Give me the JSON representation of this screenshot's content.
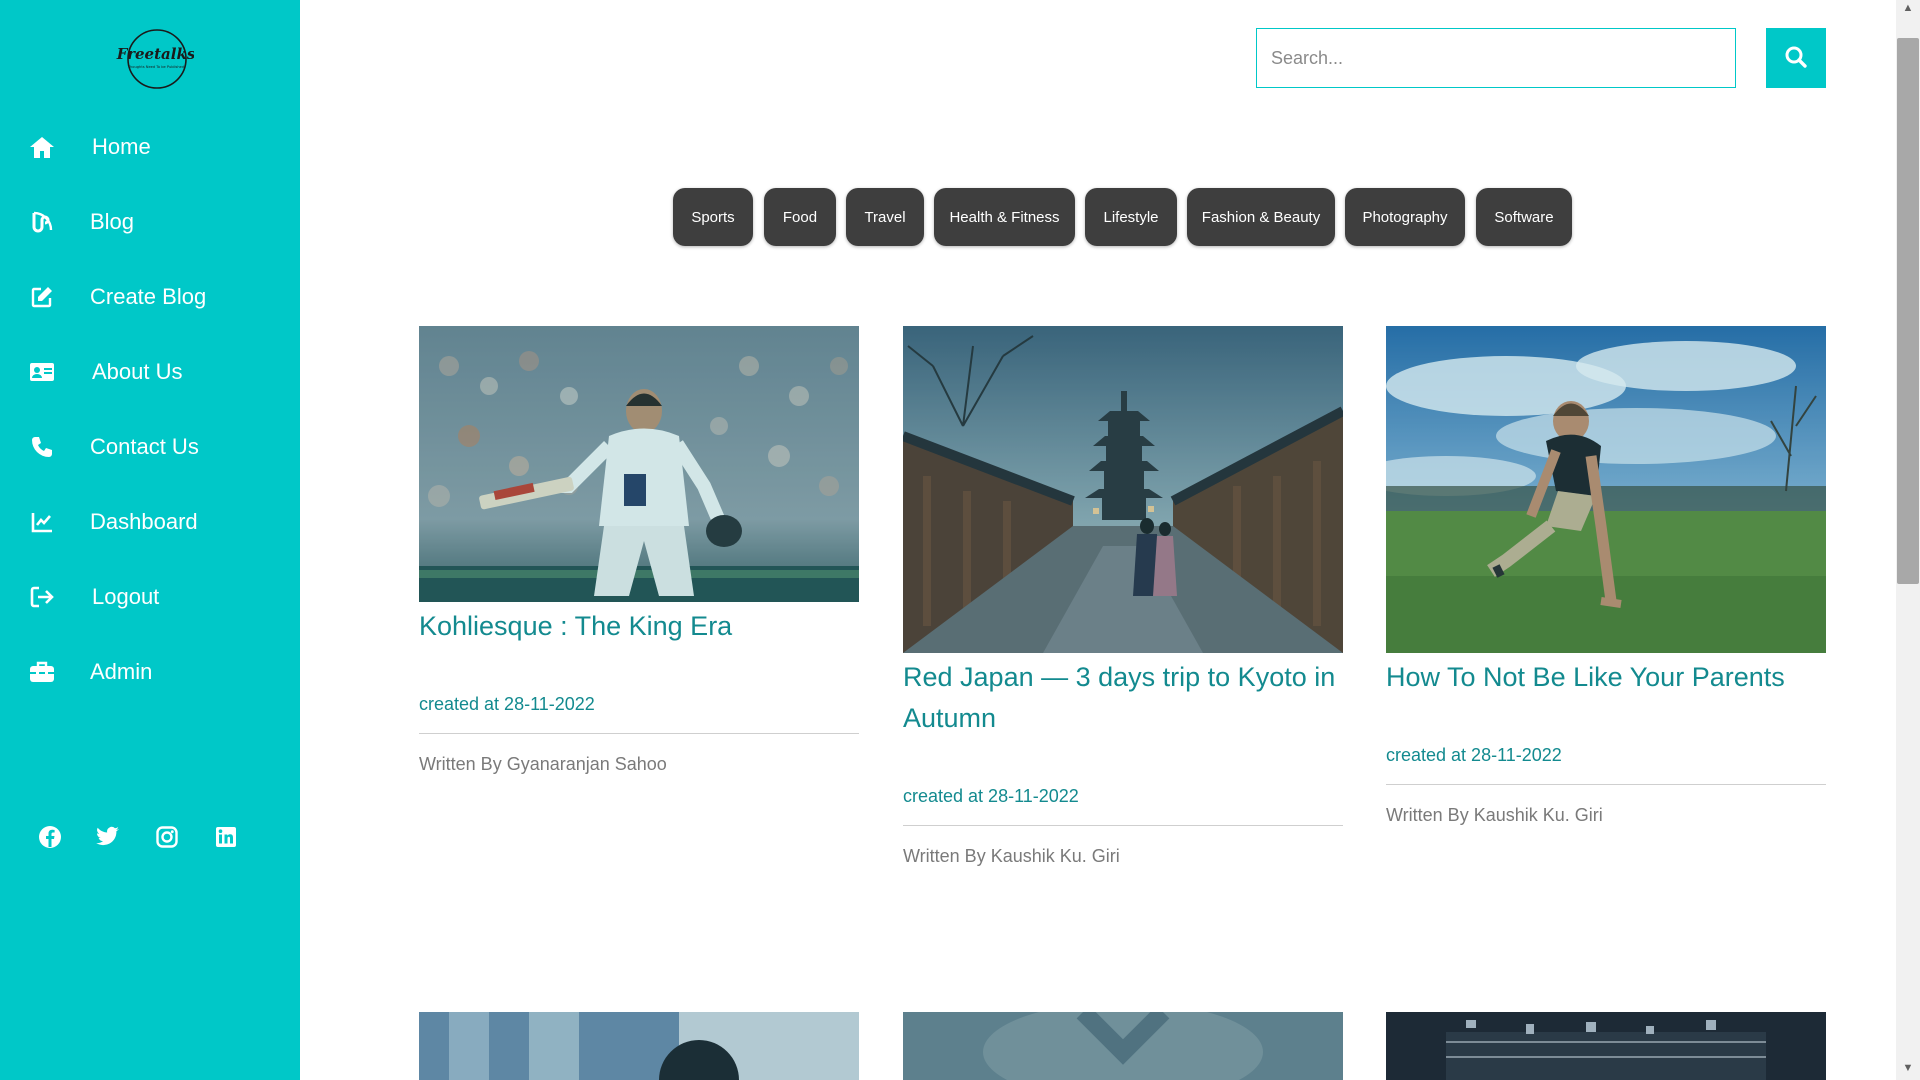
{
  "sidebar": {
    "logo_text": "Freetalks",
    "logo_tagline": "Thoughts Need To be Published",
    "items": [
      {
        "label": "Home",
        "icon": "home-icon"
      },
      {
        "label": "Blog",
        "icon": "blog-icon"
      },
      {
        "label": "Create Blog",
        "icon": "edit-icon"
      },
      {
        "label": "About Us",
        "icon": "id-card-icon"
      },
      {
        "label": "Contact Us",
        "icon": "phone-icon"
      },
      {
        "label": "Dashboard",
        "icon": "chart-line-icon"
      },
      {
        "label": "Logout",
        "icon": "logout-icon"
      },
      {
        "label": "Admin",
        "icon": "toolbox-icon"
      }
    ],
    "social": [
      "facebook-icon",
      "twitter-icon",
      "instagram-icon",
      "linkedin-icon"
    ]
  },
  "search": {
    "placeholder": "Search...",
    "value": ""
  },
  "categories": [
    "Sports",
    "Food",
    "Travel",
    "Health & Fitness",
    "Lifestyle",
    "Fashion & Beauty",
    "Photography",
    "Software"
  ],
  "posts": [
    {
      "title": "Kohliesque : The King Era",
      "created": "created at 28-11-2022",
      "author": "Written By Gyanaranjan Sahoo"
    },
    {
      "title": "Red Japan — 3 days trip to Kyoto in Autumn",
      "created": "created at 28-11-2022",
      "author": "Written By Kaushik Ku. Giri"
    },
    {
      "title": "How To Not Be Like Your Parents",
      "created": "created at 28-11-2022",
      "author": "Written By Kaushik Ku. Giri"
    }
  ],
  "colors": {
    "accent": "#00c8c8",
    "title": "#138a8f",
    "chip": "#3e3e3e"
  }
}
